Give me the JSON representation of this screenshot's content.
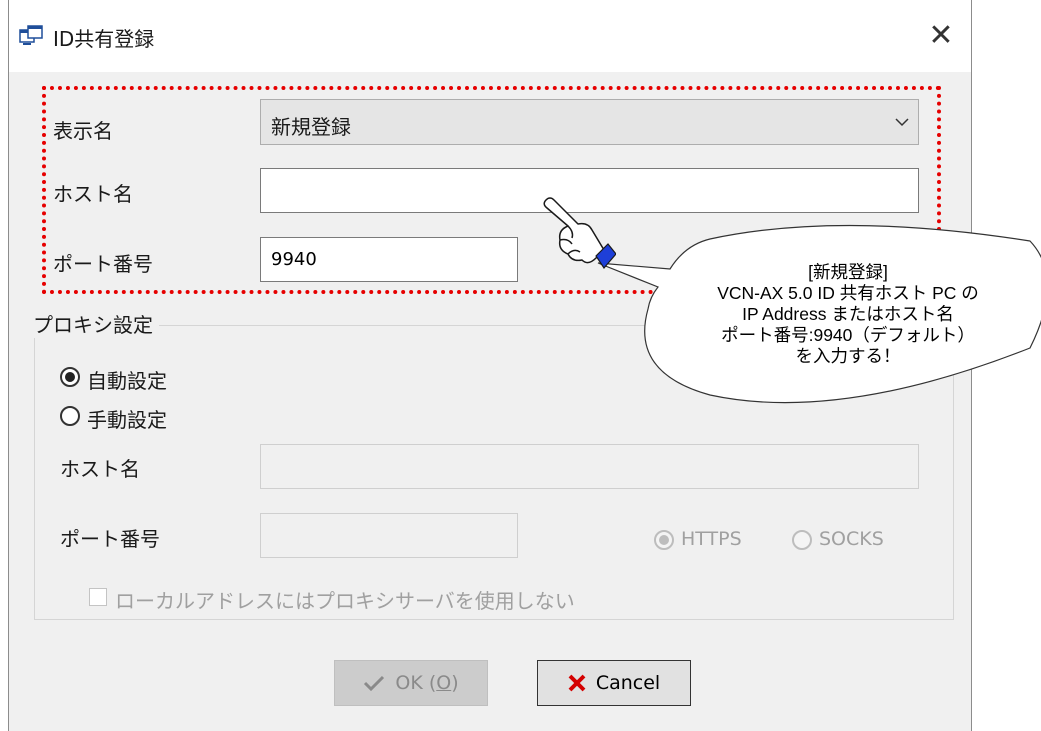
{
  "window": {
    "title": "ID共有登録",
    "close_glyph": "✕"
  },
  "form": {
    "display_name_label": "表示名",
    "display_name_value": "新規登録",
    "host_label": "ホスト名",
    "host_value": "",
    "port_label": "ポート番号",
    "port_value": "9940"
  },
  "proxy": {
    "group_title": "プロキシ設定",
    "auto_label": "自動設定",
    "manual_label": "手動設定",
    "selected": "auto",
    "host_label": "ホスト名",
    "host_value": "",
    "port_label": "ポート番号",
    "port_value": "",
    "protocol_https": "HTTPS",
    "protocol_socks": "SOCKS",
    "protocol_selected": "HTTPS",
    "no_local_label": "ローカルアドレスにはプロキシサーバを使用しない",
    "no_local_checked": false
  },
  "buttons": {
    "ok_label": "OK (",
    "ok_accel": "O",
    "ok_close": ")",
    "cancel_label": "Cancel"
  },
  "callout": {
    "lines": [
      "[新規登録]",
      "VCN-AX 5.0 ID 共有ホスト PC の",
      "IP Address またはホスト名",
      "ポート番号:9940（デフォルト）",
      "を入力する！"
    ]
  },
  "colors": {
    "highlight_border": "#e60000",
    "cancel_icon": "#d40000",
    "dialog_bg": "#f0f0f0"
  },
  "icons": [
    "window-icon",
    "close-icon",
    "chevron-down-icon",
    "check-icon",
    "cancel-x-icon",
    "pointing-hand-icon"
  ]
}
